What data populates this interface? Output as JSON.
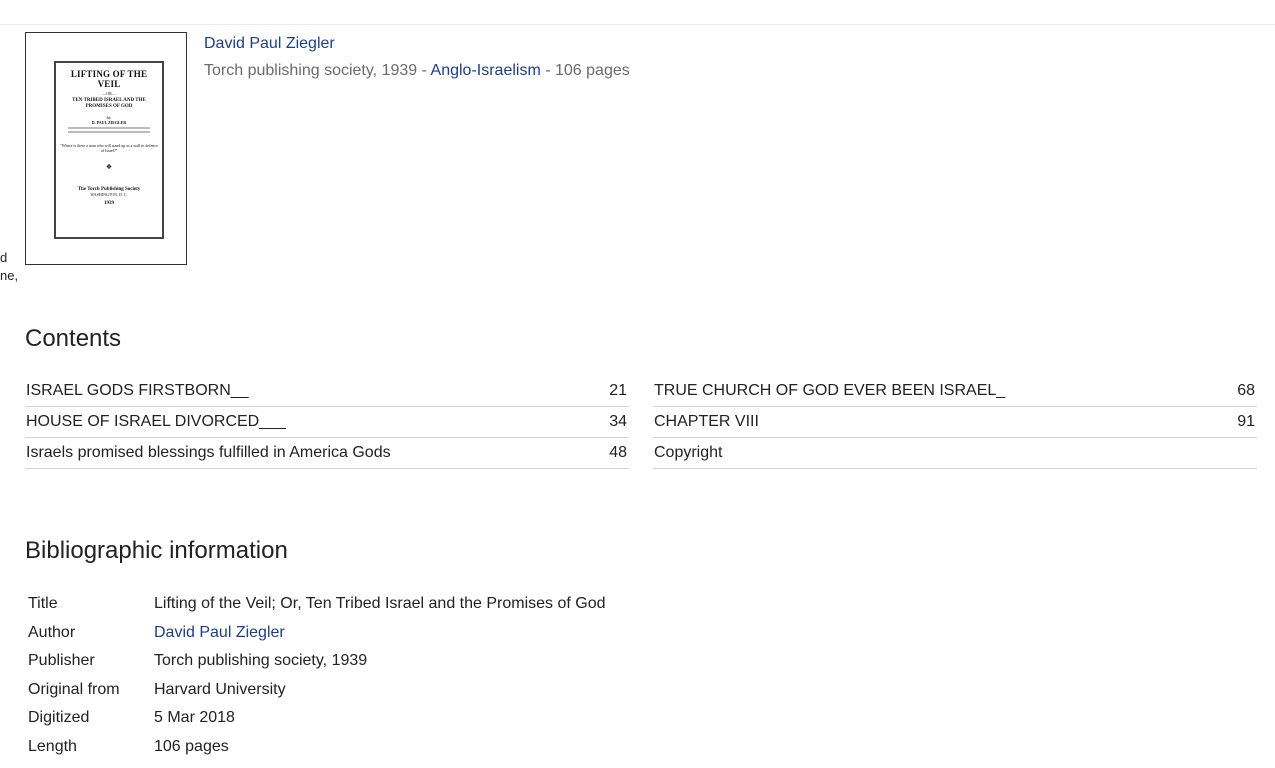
{
  "edge_snippet": [
    "d",
    "ne,"
  ],
  "book": {
    "author": "David Paul Ziegler",
    "publisher_year": "Torch publishing society, 1939",
    "sep1": " - ",
    "subject": "Anglo-Israelism",
    "sep2": " - ",
    "pages": "106 pages"
  },
  "contents": {
    "heading": "Contents",
    "left": [
      {
        "title": "ISRAEL GODS FIRSTBORN__",
        "page": "21"
      },
      {
        "title": "HOUSE OF ISRAEL DIVORCED___",
        "page": "34"
      },
      {
        "title": "Israels promised blessings fulfilled in America Gods",
        "page": "48"
      }
    ],
    "right": [
      {
        "title": "TRUE CHURCH OF GOD EVER BEEN ISRAEL_",
        "page": "68"
      },
      {
        "title": "CHAPTER VIII",
        "page": "91"
      },
      {
        "title": "Copyright",
        "page": ""
      }
    ]
  },
  "biblio": {
    "heading": "Bibliographic information",
    "rows": [
      {
        "label": "Title",
        "value": "Lifting of the Veil; Or, Ten Tribed Israel and the Promises of God"
      },
      {
        "label": "Author",
        "value": "David Paul Ziegler"
      },
      {
        "label": "Publisher",
        "value": "Torch publishing society, 1939"
      },
      {
        "label": "Original from",
        "value": "Harvard University"
      },
      {
        "label": "Digitized",
        "value": "5 Mar 2018"
      },
      {
        "label": "Length",
        "value": "106 pages"
      }
    ]
  },
  "colors": {
    "link": "#1a3f8f",
    "muted": "#6b6b6b",
    "rule": "#d4d4d4"
  }
}
